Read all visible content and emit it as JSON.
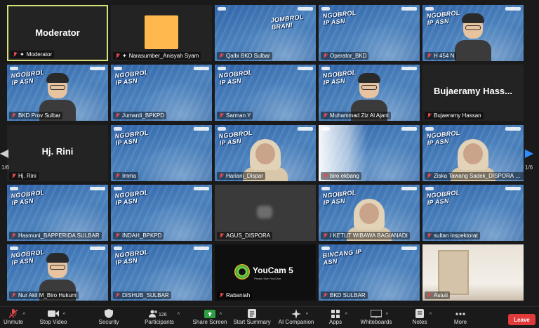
{
  "tiles": [
    {
      "name": "Moderator",
      "big": "Moderator",
      "bg": "dark",
      "active": true,
      "host": true
    },
    {
      "name": "Narasumber_Anisyah Syam",
      "bg": "dark",
      "host": true,
      "orange": true
    },
    {
      "name": "Qalbi BKD Sulbar",
      "bg": "blue",
      "banner": "JOMBROL BRANI"
    },
    {
      "name": "Operator_BKD",
      "bg": "blue",
      "banner": "NGOBROL IP ASN"
    },
    {
      "name": "H 454 N",
      "bg": "blue",
      "banner": "NGOBROL IP ASN",
      "avatar": true
    },
    {
      "name": "BKD Prov Sulbar",
      "bg": "blue",
      "banner": "NGOBROL IP ASN",
      "avatar": true
    },
    {
      "name": "Jumardi_BPKPD",
      "bg": "blue",
      "banner": "NGOBROL IP ASN"
    },
    {
      "name": "Sarman Y",
      "bg": "blue",
      "banner": "NGOBROL IP ASN"
    },
    {
      "name": "Muhammad Ziz Al Ajani",
      "bg": "blue",
      "banner": "NGOBROL IP ASN",
      "avatar": true
    },
    {
      "name": "Bujaeramy Hassan",
      "big": "Bujaeramy Hass...",
      "bg": "dark"
    },
    {
      "name": "Hj. Rini",
      "big": "Hj. Rini",
      "bg": "dark"
    },
    {
      "name": "Imma",
      "bg": "blue",
      "banner": "NGOBROL IP ASN"
    },
    {
      "name": "Hariani_Dispar",
      "bg": "blue",
      "banner": "NGOBROL IP ASN",
      "person": true
    },
    {
      "name": "biro ekbang",
      "bg": "blue",
      "banner": "",
      "haze": true
    },
    {
      "name": "Ziska Tawang Sadek_DISPORA Pro...",
      "bg": "blue",
      "banner": "NGOBROL IP ASN",
      "person": true
    },
    {
      "name": "Hasmuni_BAPPERIDA SULBAR",
      "bg": "blue",
      "banner": "NGOBROL IP ASN"
    },
    {
      "name": "INDAH_BPKPD",
      "bg": "blue",
      "banner": "NGOBROL IP ASN"
    },
    {
      "name": "AGUS_DISPORA",
      "bg": "gray",
      "blob": true
    },
    {
      "name": "I KETUT WIBAWA BAGIANADI",
      "bg": "blue",
      "banner": "NGOBROL IP ASN",
      "person": true
    },
    {
      "name": "sultan inspektorat",
      "bg": "blue",
      "banner": "NGOBROL IP ASN"
    },
    {
      "name": "Nur Akil M_Biro Hukum",
      "bg": "blue",
      "banner": "NGOBROL IP ASN",
      "avatar": true
    },
    {
      "name": "DISHUB_SULBAR",
      "bg": "blue",
      "banner": "NGOBROL IP ASN"
    },
    {
      "name": "Rabaniah",
      "bg": "black",
      "youcam": true
    },
    {
      "name": "BKD SULBAR",
      "bg": "blue",
      "banner": "BINCANG IP ASN"
    },
    {
      "name": "Astuti",
      "bg": "room",
      "door": true
    }
  ],
  "youcam": {
    "title": "YouCam 5",
    "sub": "Please Start YouCam"
  },
  "paging": {
    "left": "1/6",
    "right": "1/6"
  },
  "toolbar": {
    "items": [
      {
        "key": "unmute",
        "label": "Unmute",
        "icon": "mic-muted-icon"
      },
      {
        "key": "video",
        "label": "Stop Video",
        "icon": "video-icon"
      },
      {
        "key": "security",
        "label": "Security",
        "icon": "shield-icon"
      },
      {
        "key": "participants",
        "label": "Participants",
        "icon": "participants-icon",
        "count": "126"
      },
      {
        "key": "share",
        "label": "Share Screen",
        "icon": "share-screen-icon"
      },
      {
        "key": "summary",
        "label": "Start Summary",
        "icon": "summary-icon"
      },
      {
        "key": "companion",
        "label": "AI Companion",
        "icon": "ai-companion-icon"
      },
      {
        "key": "apps",
        "label": "Apps",
        "icon": "apps-icon"
      },
      {
        "key": "whiteboards",
        "label": "Whiteboards",
        "icon": "whiteboard-icon"
      },
      {
        "key": "notes",
        "label": "Notes",
        "icon": "notes-icon"
      },
      {
        "key": "more",
        "label": "More",
        "icon": "more-icon"
      }
    ],
    "leave": "Leave"
  },
  "colors": {
    "accent": "#2d8cff",
    "share": "#2ea043",
    "leave": "#e03a3a",
    "muted": "#e5484d",
    "active_border": "#d9e27a"
  }
}
